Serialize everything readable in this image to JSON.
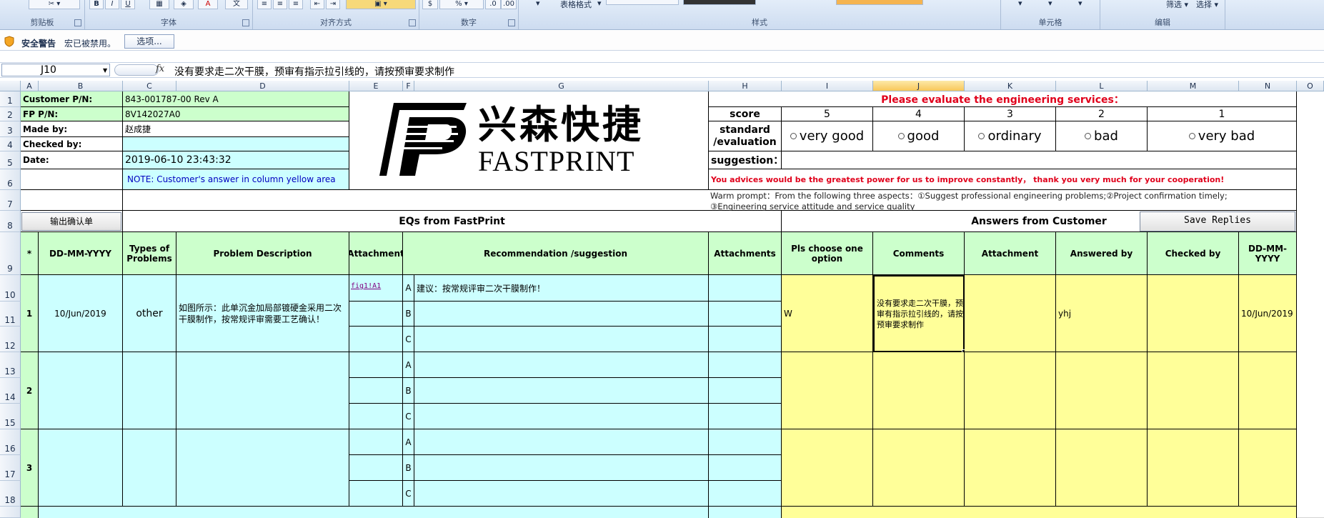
{
  "ribbon": {
    "groups": [
      "剪贴板",
      "字体",
      "对齐方式",
      "数字",
      "样式",
      "单元格",
      "编辑"
    ],
    "table_format": "表格格式",
    "filter": "筛选",
    "select": "选择"
  },
  "security": {
    "title": "安全警告",
    "message": "宏已被禁用。",
    "options_button": "选项..."
  },
  "formula_bar": {
    "name_box": "J10",
    "fx": "fx",
    "content": "没有要求走二次干膜，预审有指示拉引线的，请按预审要求制作"
  },
  "columns": [
    "A",
    "B",
    "C",
    "D",
    "E",
    "F",
    "G",
    "H",
    "I",
    "J",
    "K",
    "L",
    "M",
    "N",
    "O"
  ],
  "rows": [
    "1",
    "2",
    "3",
    "4",
    "5",
    "6",
    "7",
    "8",
    "9",
    "10",
    "11",
    "12",
    "13",
    "14",
    "15",
    "16",
    "17",
    "18"
  ],
  "header": {
    "customer_pn_label": "Customer P/N:",
    "customer_pn": "843-001787-00 Rev A",
    "fp_pn_label": "FP P/N:",
    "fp_pn": "8V142027A0",
    "made_by_label": "Made by:",
    "made_by": "赵成捷",
    "checked_by_label": "Checked by:",
    "date_label": "Date:",
    "date": "2019-06-10 23:43:32",
    "note": "NOTE: Customer's  answer in column yellow area"
  },
  "logo": {
    "cn": "兴森快捷",
    "en": "FASTPRINT"
  },
  "evaluation": {
    "title": "Please evaluate the engineering services：",
    "score_label": "score",
    "scores": [
      "5",
      "4",
      "3",
      "2",
      "1"
    ],
    "standard_label_1": "standard",
    "standard_label_2": "/evaluation",
    "options": [
      "very good",
      "good",
      "ordinary",
      "bad",
      "very bad"
    ],
    "suggestion_label": "suggestion：",
    "advice": "You advices would be the greatest power for us to improve constantly， thank you very much for your cooperation!",
    "warm_prompt_1": "Warm prompt：From the following three aspects：①Suggest professional engineering problems;②Project confirmation timely;",
    "warm_prompt_2": "③Engineering service attitude and service quality"
  },
  "sections": {
    "output_button": "输出确认单",
    "eqs": "EQs from FastPrint",
    "answers": "Answers from Customer",
    "save_button": "Save Replies"
  },
  "table_headers": {
    "star": "*",
    "date": "DD-MM-YYYY",
    "types": "Types of Problems",
    "problem": "Problem Description",
    "attachment": "Attachment",
    "recommendation": "Recommendation /suggestion",
    "attachments": "Attachments",
    "choose": "Pls choose one option",
    "comments": "Comments",
    "attachment2": "Attachment",
    "answered_by": "Answered by",
    "checked_by": "Checked by",
    "date2": "DD-MM-YYYY"
  },
  "eqs": [
    {
      "num": "1",
      "date": "10/Jun/2019",
      "type": "other",
      "problem": "如图所示：此单沉金加局部镀硬金采用二次干膜制作，按常规评审需要工艺确认！",
      "attachment": "fig1!A1",
      "options": [
        "A",
        "B",
        "C"
      ],
      "recommendations": [
        "建议：按常规评审二次干膜制作！",
        "",
        ""
      ],
      "choice": "W",
      "comment": "没有要求走二次干膜，预审有指示拉引线的，请按预审要求制作",
      "answered_by": "yhj",
      "answer_date": "10/Jun/2019"
    },
    {
      "num": "2",
      "options": [
        "A",
        "B",
        "C"
      ]
    },
    {
      "num": "3",
      "options": [
        "A",
        "B",
        "C"
      ]
    }
  ]
}
